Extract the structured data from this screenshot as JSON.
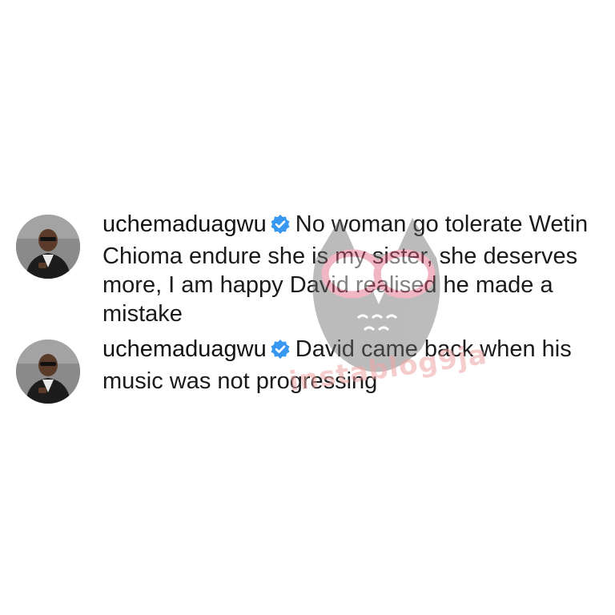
{
  "comments": [
    {
      "username": "uchemaduagwu",
      "verified_icon": "verified-badge-icon",
      "text": "No woman go tolerate Wetin Chioma endure she is my sister, she deserves more, I am happy David realised he made a mistake"
    },
    {
      "username": "uchemaduagwu",
      "verified_icon": "verified-badge-icon",
      "text": "David came back when his music was not progressing"
    }
  ],
  "watermark": {
    "text": "instablog9ja"
  },
  "colors": {
    "verified_blue": "#3897f0",
    "text": "#1a1a1a",
    "watermark_pink": "#f0a6a6"
  }
}
